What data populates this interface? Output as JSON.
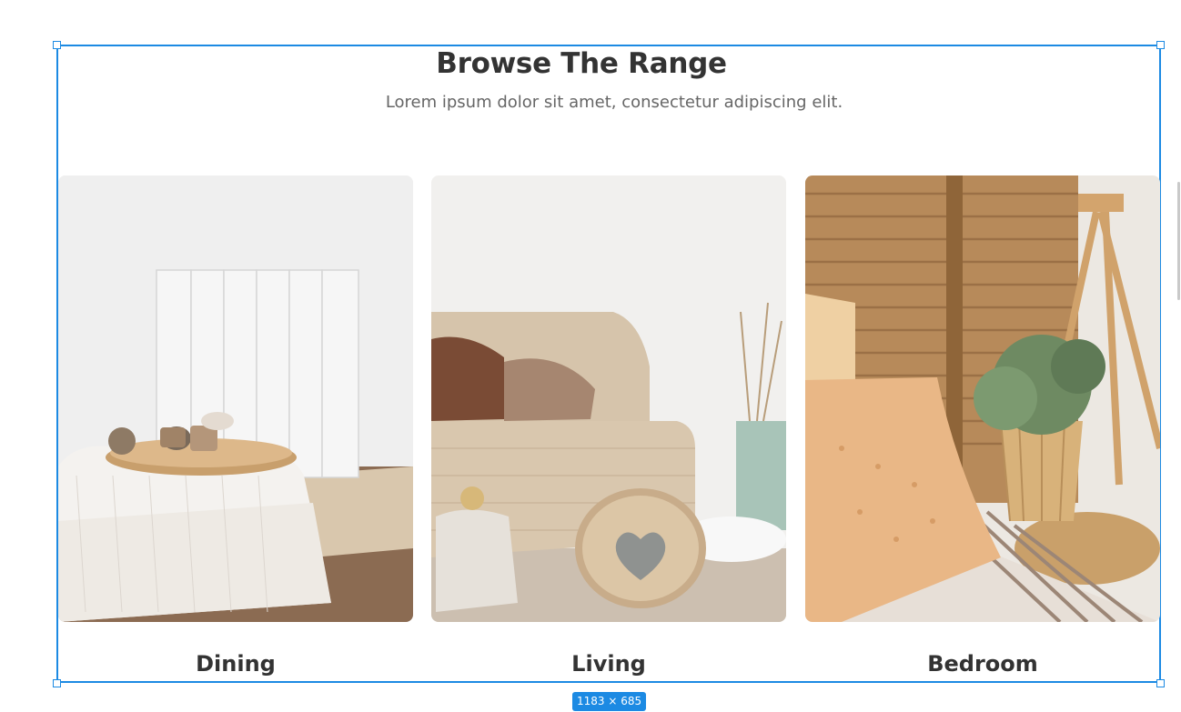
{
  "section": {
    "title": "Browse The Range",
    "subtitle": "Lorem ipsum dolor sit amet, consectetur adipiscing elit."
  },
  "categories": [
    {
      "label": "Dining",
      "image": "dining-room-photo"
    },
    {
      "label": "Living",
      "image": "living-room-photo"
    },
    {
      "label": "Bedroom",
      "image": "bedroom-photo"
    }
  ],
  "selection": {
    "size_label": "1183 × 685",
    "color": "#1c8ae3"
  },
  "colors": {
    "heading": "#333333",
    "subtext": "#666666"
  }
}
